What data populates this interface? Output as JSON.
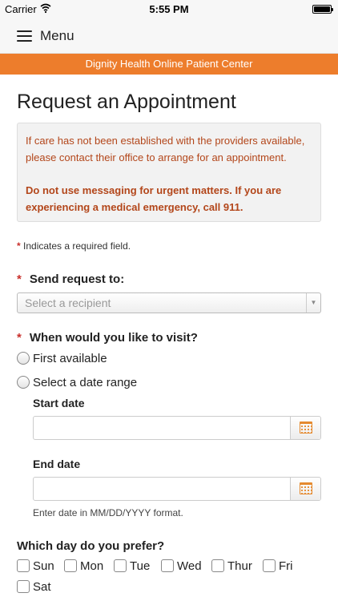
{
  "status_bar": {
    "carrier": "Carrier",
    "time": "5:55 PM"
  },
  "navbar": {
    "menu_label": "Menu"
  },
  "banner": {
    "text": "Dignity Health Online Patient Center"
  },
  "page": {
    "title": "Request an Appointment"
  },
  "alert": {
    "line1": "If care has not been established with the providers available, please contact their office to arrange for an appointment.",
    "line2": "Do not use messaging for urgent matters. If you are experiencing a medical emergency, call 911."
  },
  "required_note": {
    "asterisk": "*",
    "text": "Indicates a required field."
  },
  "send_to": {
    "asterisk": "*",
    "label": "Send request to:",
    "placeholder": "Select a recipient"
  },
  "visit": {
    "asterisk": "*",
    "label": "When would you like to visit?",
    "options": [
      "First available",
      "Select a date range"
    ]
  },
  "date_range": {
    "start_label": "Start date",
    "end_label": "End date",
    "hint": "Enter date in MM/DD/YYYY format."
  },
  "days": {
    "label": "Which day do you prefer?",
    "options": [
      "Sun",
      "Mon",
      "Tue",
      "Wed",
      "Thur",
      "Fri",
      "Sat"
    ]
  },
  "colors": {
    "accent": "#ed7d2c",
    "alert_text": "#b3461a",
    "required": "#c9302c"
  }
}
